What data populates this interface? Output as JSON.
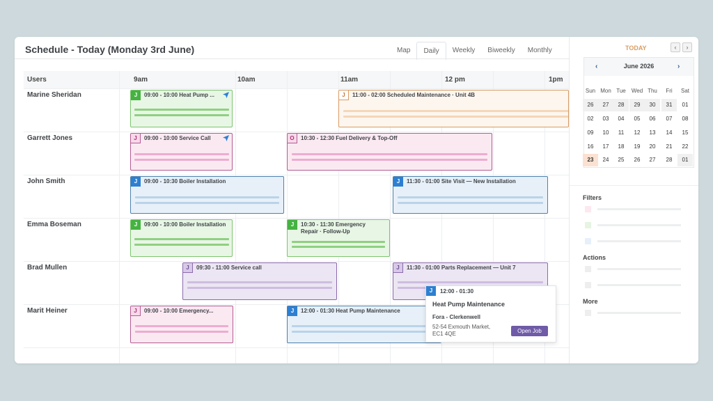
{
  "header": {
    "title": "Schedule - Today (Monday 3rd June)",
    "view_tabs": [
      "Map",
      "Daily",
      "Weekly",
      "Biweekly",
      "Monthly"
    ],
    "active_tab": "Daily"
  },
  "grid": {
    "users_header": "Users",
    "hours": [
      "9am",
      "10am",
      "11am",
      "12 pm",
      "1pm"
    ],
    "users": [
      "Marine Sheridan",
      "Garrett Jones",
      "John Smith",
      "Emma Boseman",
      "Brad Mullen",
      "Marit Heiner"
    ]
  },
  "events": [
    {
      "row": 0,
      "badge": "J",
      "text": "09:00 - 10:00 Heat Pump ...",
      "color": "green",
      "icon": "navigation-arrow-icon"
    },
    {
      "row": 0,
      "badge": "J",
      "text": "11:00 - 02:00 Scheduled Maintenance · Unit 4B",
      "color": "orange"
    },
    {
      "row": 1,
      "badge": "J",
      "text": "09:00 - 10:00 Service Call",
      "color": "pink",
      "icon": "navigation-arrow-icon"
    },
    {
      "row": 1,
      "badge": "O",
      "text": "10:30 - 12:30 Fuel Delivery & Top-Off",
      "color": "pink"
    },
    {
      "row": 2,
      "badge": "J",
      "text": "09:00 - 10:30 Boiler Installation",
      "color": "blue"
    },
    {
      "row": 2,
      "badge": "J",
      "text": "11:30 - 01:00 Site Visit — New Installation",
      "color": "blue"
    },
    {
      "row": 3,
      "badge": "J",
      "text": "09:00 - 10:00 Boiler Installation",
      "color": "green"
    },
    {
      "row": 3,
      "badge": "J",
      "text": "10:30 - 11:30 Emergency Repair · Follow-Up",
      "color": "green"
    },
    {
      "row": 4,
      "badge": "J",
      "text": "09:30 - 11:00 Service call",
      "color": "purple"
    },
    {
      "row": 4,
      "badge": "J",
      "text": "11:30 - 01:00 Parts Replacement — Unit 7",
      "color": "purple"
    },
    {
      "row": 5,
      "badge": "J",
      "text": "09:00 - 10:00 Emergency...",
      "color": "pink"
    },
    {
      "row": 5,
      "badge": "J",
      "text": "12:00 - 01:30 Heat Pump Maintenance",
      "color": "blue"
    }
  ],
  "popup": {
    "badge": "J",
    "time": "12:00 - 01:30",
    "title": "Heat Pump Maintenance",
    "customer": "Fora - Clerkenwell",
    "address": "52-54 Exmouth Market, EC1 4QE",
    "button": "Open Job"
  },
  "sidebar": {
    "today_label": "TODAY",
    "prev": "‹",
    "next": "›",
    "calendar": {
      "month": "June 2026",
      "prev": "‹",
      "next": "›",
      "weekdays": [
        "Sun",
        "Mon",
        "Tue",
        "Wed",
        "Thu",
        "Fri",
        "Sat"
      ],
      "weeks": [
        [
          "26",
          "27",
          "28",
          "29",
          "30",
          "31",
          "01"
        ],
        [
          "02",
          "03",
          "04",
          "05",
          "06",
          "07",
          "08"
        ],
        [
          "09",
          "10",
          "11",
          "12",
          "13",
          "14",
          "15"
        ],
        [
          "16",
          "17",
          "18",
          "19",
          "20",
          "21",
          "22"
        ],
        [
          "23",
          "24",
          "25",
          "26",
          "27",
          "28",
          "01"
        ]
      ],
      "today": "23"
    },
    "sections": [
      "Filters",
      "Actions",
      "More"
    ],
    "filter_swatches": [
      "#fde8ef",
      "#e6f4e1",
      "#e6f0fb"
    ]
  }
}
